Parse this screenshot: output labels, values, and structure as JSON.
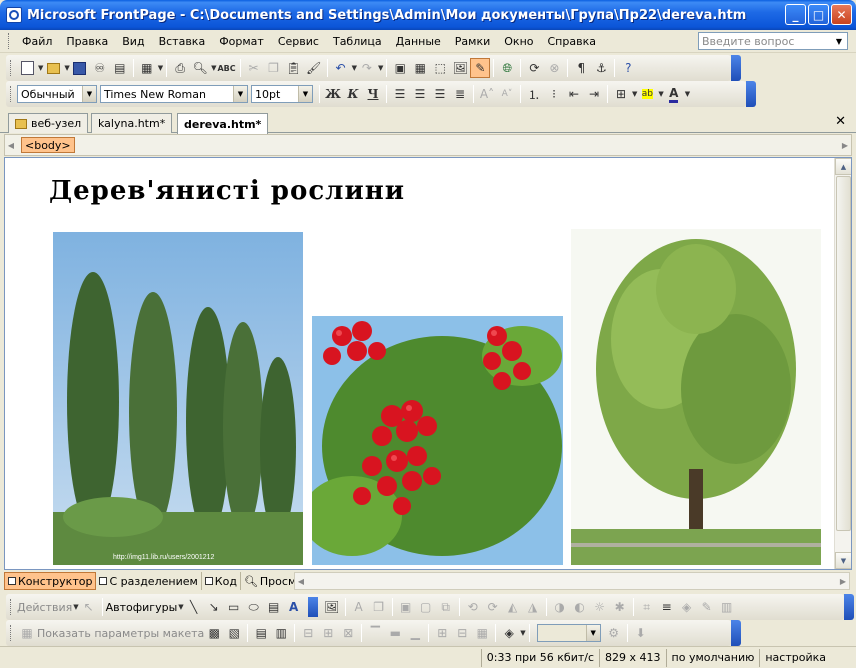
{
  "window": {
    "title": "Microsoft FrontPage - C:\\Documents and Settings\\Admin\\Мои документы\\Група\\Пр22\\dereva.htm"
  },
  "menu": {
    "items": [
      "Файл",
      "Правка",
      "Вид",
      "Вставка",
      "Формат",
      "Сервис",
      "Таблица",
      "Данные",
      "Рамки",
      "Окно",
      "Справка"
    ],
    "help_placeholder": "Введите вопрос"
  },
  "formatting": {
    "style": "Обычный",
    "font": "Times New Roman",
    "size": "10pt",
    "bold": "Ж",
    "italic": "К",
    "underline": "Ч"
  },
  "tabs": [
    {
      "label": "веб-узел"
    },
    {
      "label": "kalyna.htm*"
    },
    {
      "label": "dereva.htm*"
    }
  ],
  "tag": "<body>",
  "page": {
    "heading": "Дерев'янисті рослини",
    "image_caption": "http://img11.lib.ru/users/2001212"
  },
  "view_tabs": [
    {
      "label": "Конструктор"
    },
    {
      "label": "С разделением"
    },
    {
      "label": "Код"
    },
    {
      "label": "Просмотр"
    }
  ],
  "drawing_toolbar": {
    "actions": "Действия",
    "autoshapes": "Автофигуры"
  },
  "layout_toolbar": {
    "show_params": "Показать параметры макета"
  },
  "status": {
    "speed": "0:33 при 56 кбит/с",
    "dims": "829 x 413",
    "default": "по умолчанию",
    "custom": "настройка"
  }
}
